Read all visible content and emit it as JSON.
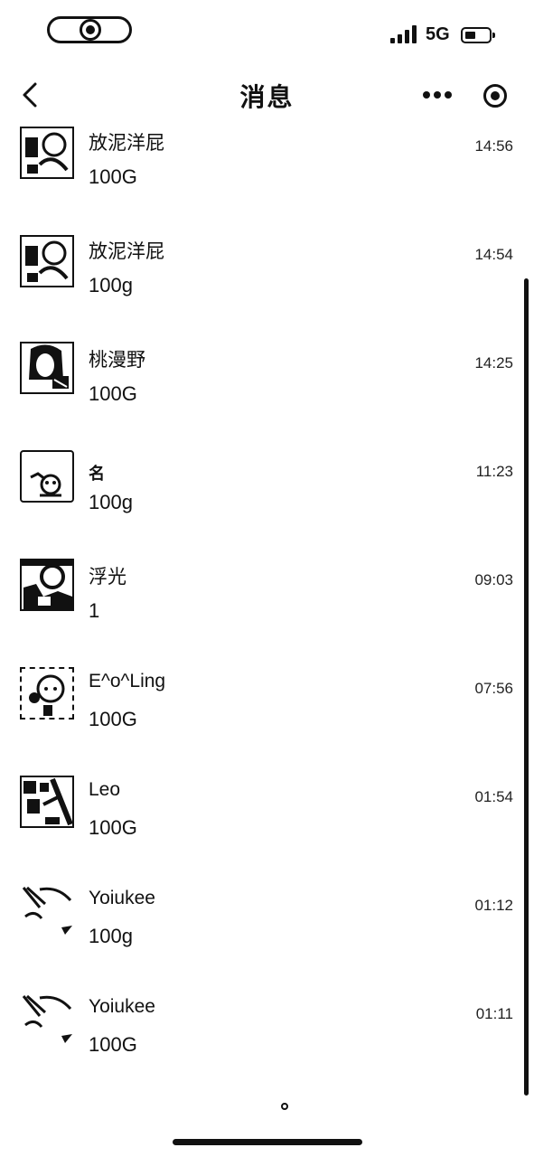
{
  "status_bar": {
    "network": "5G"
  },
  "nav": {
    "title": "消息",
    "back_icon": "chevron-left-icon",
    "more_icon": "more-dots-icon",
    "target_icon": "record-circle-icon"
  },
  "messages": [
    {
      "name": "放泥洋屁",
      "preview": "100G",
      "time": "14:56",
      "avatar": "cartoon-avatar-1"
    },
    {
      "name": "放泥洋屁",
      "preview": "100g",
      "time": "14:54",
      "avatar": "cartoon-avatar-1"
    },
    {
      "name": "桃漫野",
      "preview": "100G",
      "time": "14:25",
      "avatar": "girl-avatar"
    },
    {
      "name": "名",
      "preview": "100g",
      "time": "11:23",
      "avatar": "dog-avatar"
    },
    {
      "name": "浮光",
      "preview": "1",
      "time": "09:03",
      "avatar": "person-avatar"
    },
    {
      "name": "E^o^Ling",
      "preview": "100G",
      "time": "07:56",
      "avatar": "cartoon-avatar-2"
    },
    {
      "name": "Leo",
      "preview": "100G",
      "time": "01:54",
      "avatar": "pattern-avatar"
    },
    {
      "name": "Yoiukee",
      "preview": "100g",
      "time": "01:12",
      "avatar": "anime-avatar"
    },
    {
      "name": "Yoiukee",
      "preview": "100G",
      "time": "01:11",
      "avatar": "anime-avatar"
    }
  ]
}
